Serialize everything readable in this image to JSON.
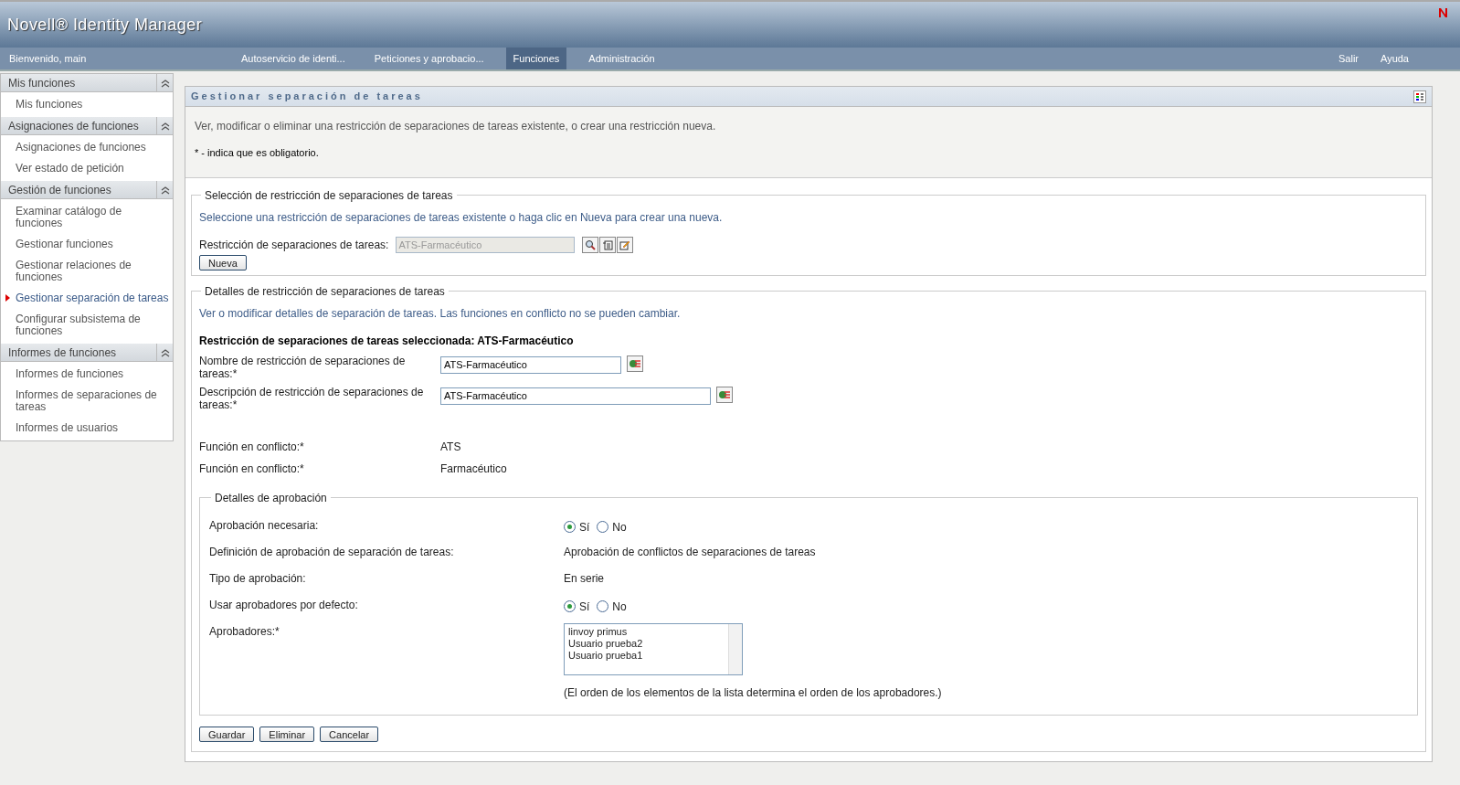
{
  "header": {
    "title": "Novell® Identity Manager"
  },
  "nav": {
    "welcome": "Bienvenido, main",
    "tabs": [
      {
        "label": "Autoservicio de identi...",
        "selected": false
      },
      {
        "label": "Peticiones y aprobacio...",
        "selected": false
      },
      {
        "label": "Funciones",
        "selected": true
      },
      {
        "label": "Administración",
        "selected": false
      }
    ],
    "links": [
      "Salir",
      "Ayuda"
    ]
  },
  "sidebar": {
    "sections": [
      {
        "title": "Mis funciones",
        "items": [
          {
            "label": "Mis funciones",
            "selected": false
          }
        ]
      },
      {
        "title": "Asignaciones de funciones",
        "items": [
          {
            "label": "Asignaciones de funciones",
            "selected": false
          },
          {
            "label": "Ver estado de petición",
            "selected": false
          }
        ]
      },
      {
        "title": "Gestión de funciones",
        "items": [
          {
            "label": "Examinar catálogo de funciones",
            "selected": false
          },
          {
            "label": "Gestionar funciones",
            "selected": false
          },
          {
            "label": "Gestionar relaciones de funciones",
            "selected": false
          },
          {
            "label": "Gestionar separación de tareas",
            "selected": true
          },
          {
            "label": "Configurar subsistema de funciones",
            "selected": false
          }
        ]
      },
      {
        "title": "Informes de funciones",
        "items": [
          {
            "label": "Informes de funciones",
            "selected": false
          },
          {
            "label": "Informes de separaciones de tareas",
            "selected": false
          },
          {
            "label": "Informes de usuarios",
            "selected": false
          }
        ]
      }
    ]
  },
  "page": {
    "title": "Gestionar separación de tareas",
    "intro": "Ver, modificar o eliminar una restricción de separaciones de tareas existente, o crear una restricción nueva.",
    "required_note": "* - indica que es obligatorio.",
    "selection": {
      "legend": "Selección de restricción de separaciones de tareas",
      "hint": "Seleccione una restricción de separaciones de tareas existente o haga clic en Nueva para crear una nueva.",
      "field_label": "Restricción de separaciones de tareas:",
      "field_value": "ATS-Farmacéutico",
      "disabled": true,
      "new_button": "Nueva"
    },
    "details": {
      "legend": "Detalles de restricción de separaciones de tareas",
      "hint": "Ver o modificar detalles de separación de tareas. Las funciones en conflicto no se pueden cambiar.",
      "selected_heading": "Restricción de separaciones de tareas seleccionada: ATS-Farmacéutico",
      "fields": [
        {
          "label": "Nombre de restricción de separaciones de tareas:*",
          "value": "ATS-Farmacéutico",
          "wide": false
        },
        {
          "label": "Descripción de restricción de separaciones de tareas:*",
          "value": "ATS-Farmacéutico",
          "wide": true
        }
      ],
      "conflicts": [
        {
          "label": "Función en conflicto:*",
          "value": "ATS"
        },
        {
          "label": "Función en conflicto:*",
          "value": "Farmacéutico"
        }
      ]
    },
    "approval": {
      "legend": "Detalles de aprobación",
      "rows": [
        {
          "kind": "radio",
          "label": "Aprobación necesaria:",
          "options": [
            {
              "label": "Sí",
              "selected": true
            },
            {
              "label": "No",
              "selected": false
            }
          ]
        },
        {
          "kind": "text",
          "label": "Definición de aprobación de separación de tareas:",
          "value": "Aprobación de conflictos de separaciones de tareas"
        },
        {
          "kind": "text",
          "label": "Tipo de aprobación:",
          "value": "En serie"
        },
        {
          "kind": "radio",
          "label": "Usar aprobadores por defecto:",
          "options": [
            {
              "label": "Sí",
              "selected": true
            },
            {
              "label": "No",
              "selected": false
            }
          ]
        },
        {
          "kind": "list",
          "label": "Aprobadores:*",
          "items": [
            "linvoy primus",
            "Usuario prueba2",
            "Usuario prueba1"
          ],
          "note": "(El orden de los elementos de la lista determina el orden de los aprobadores.)"
        }
      ]
    },
    "buttons": [
      "Guardar",
      "Eliminar",
      "Cancelar"
    ]
  }
}
